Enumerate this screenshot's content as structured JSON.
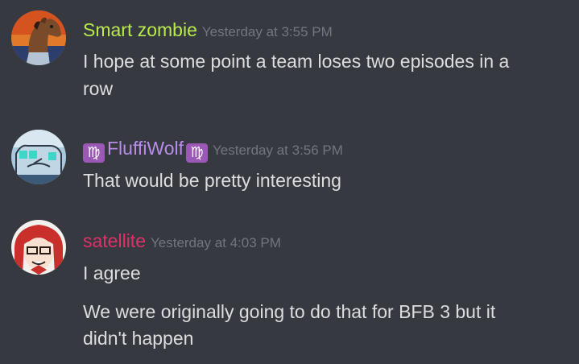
{
  "colors": {
    "background": "#36393f",
    "message_text": "#dcddde",
    "timestamp": "#72767d",
    "smart_zombie_name": "#b9e94f",
    "fluffiwolf_name": "#b88ce8",
    "satellite_name": "#e0306a",
    "zodiac_badge": "#9b59b6"
  },
  "messages": [
    {
      "author": "Smart zombie",
      "timestamp": "Yesterday at 3:55 PM",
      "avatar_icon": "horse-cartoon-avatar",
      "lines": [
        "I hope at some point a team loses two episodes in a",
        "row"
      ]
    },
    {
      "author": "FluffiWolf",
      "author_badge": "♍",
      "timestamp": "Yesterday at 3:56 PM",
      "avatar_icon": "wolf-drawing-avatar",
      "lines": [
        "That would be pretty interesting"
      ]
    },
    {
      "author": "satellite",
      "timestamp": "Yesterday at 4:03 PM",
      "avatar_icon": "red-hair-girl-avatar",
      "lines": [
        "I agree"
      ],
      "followup_lines": [
        "We were originally going to do that for BFB 3 but it",
        "didn't happen"
      ]
    }
  ]
}
